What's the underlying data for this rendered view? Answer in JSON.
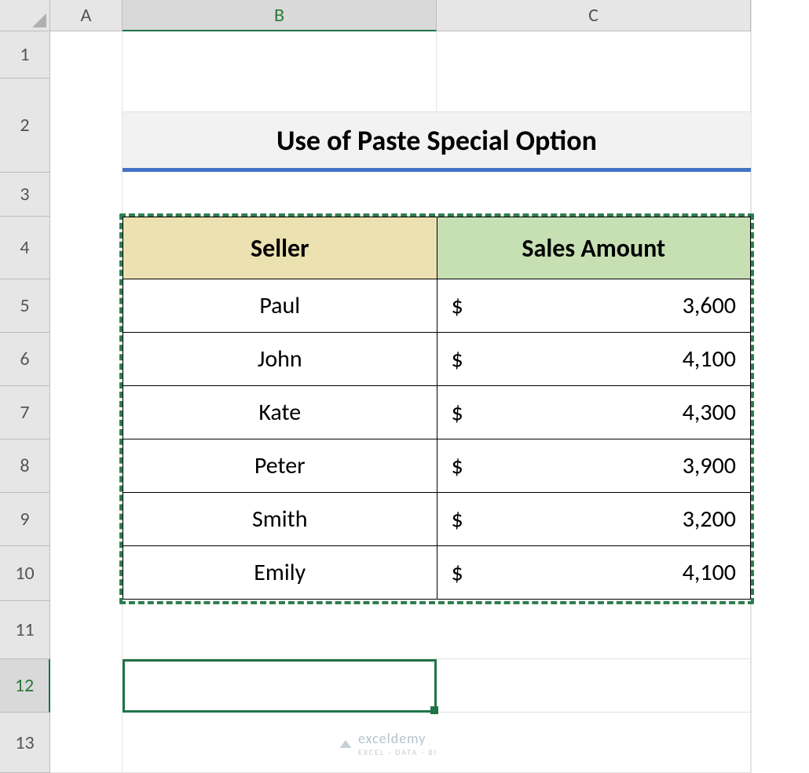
{
  "columns": {
    "A": "A",
    "B": "B",
    "C": "C"
  },
  "rows": [
    "1",
    "2",
    "3",
    "4",
    "5",
    "6",
    "7",
    "8",
    "9",
    "10",
    "11",
    "12",
    "13"
  ],
  "title": "Use of Paste Special Option",
  "table": {
    "headers": {
      "seller": "Seller",
      "amount": "Sales Amount"
    },
    "currency": "$",
    "data": [
      {
        "seller": "Paul",
        "amount": "3,600"
      },
      {
        "seller": "John",
        "amount": "4,100"
      },
      {
        "seller": "Kate",
        "amount": "4,300"
      },
      {
        "seller": "Peter",
        "amount": "3,900"
      },
      {
        "seller": "Smith",
        "amount": "3,200"
      },
      {
        "seller": "Emily",
        "amount": "4,100"
      }
    ]
  },
  "watermark": {
    "brand": "exceldemy",
    "tag": "EXCEL · DATA · BI"
  },
  "chart_data": {
    "type": "table",
    "title": "Use of Paste Special Option",
    "columns": [
      "Seller",
      "Sales Amount"
    ],
    "rows": [
      [
        "Paul",
        3600
      ],
      [
        "John",
        4100
      ],
      [
        "Kate",
        4300
      ],
      [
        "Peter",
        3900
      ],
      [
        "Smith",
        3200
      ],
      [
        "Emily",
        4100
      ]
    ],
    "currency": "USD"
  }
}
